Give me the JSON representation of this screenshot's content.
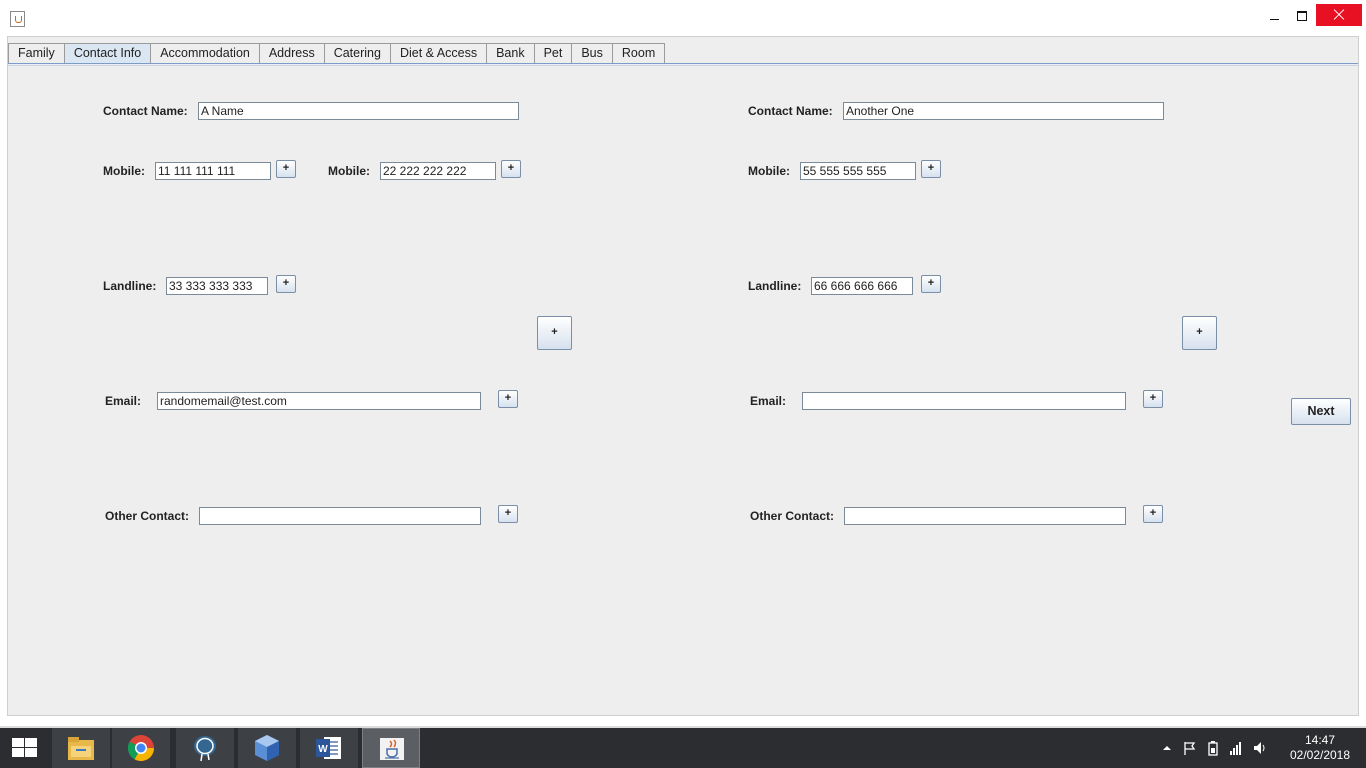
{
  "tabs": [
    "Family",
    "Contact Info",
    "Accommodation",
    "Address",
    "Catering",
    "Diet & Access",
    "Bank",
    "Pet",
    "Bus",
    "Room"
  ],
  "active_tab": "Contact Info",
  "left": {
    "contact_name_label": "Contact Name:",
    "contact_name_value": "A Name",
    "mobile_label": "Mobile:",
    "mobile1_value": "11 111 111 111",
    "mobile2_label": "Mobile:",
    "mobile2_value": "22 222 222 222",
    "landline_label": "Landline:",
    "landline_value": "33 333 333 333",
    "email_label": "Email:",
    "email_value": "randomemail@test.com",
    "other_label": "Other Contact:",
    "other_value": ""
  },
  "right": {
    "contact_name_label": "Contact Name:",
    "contact_name_value": "Another One",
    "mobile_label": "Mobile:",
    "mobile_value": "55 555 555 555",
    "landline_label": "Landline:",
    "landline_value": "66 666 666 666",
    "email_label": "Email:",
    "email_value": "",
    "other_label": "Other Contact:",
    "other_value": ""
  },
  "plus_label": "+",
  "next_label": "Next",
  "clock": {
    "time": "14:47",
    "date": "02/02/2018"
  },
  "taskbar_apps": [
    "file-explorer-icon",
    "chrome-icon",
    "postgres-icon",
    "virtualbox-icon",
    "word-icon",
    "java-icon"
  ],
  "colors": {
    "content_bg": "#eeeeee",
    "active_tab_bg": "#dbe6f3",
    "close_red": "#e81123",
    "taskbar_bg": "#2b2d30"
  }
}
